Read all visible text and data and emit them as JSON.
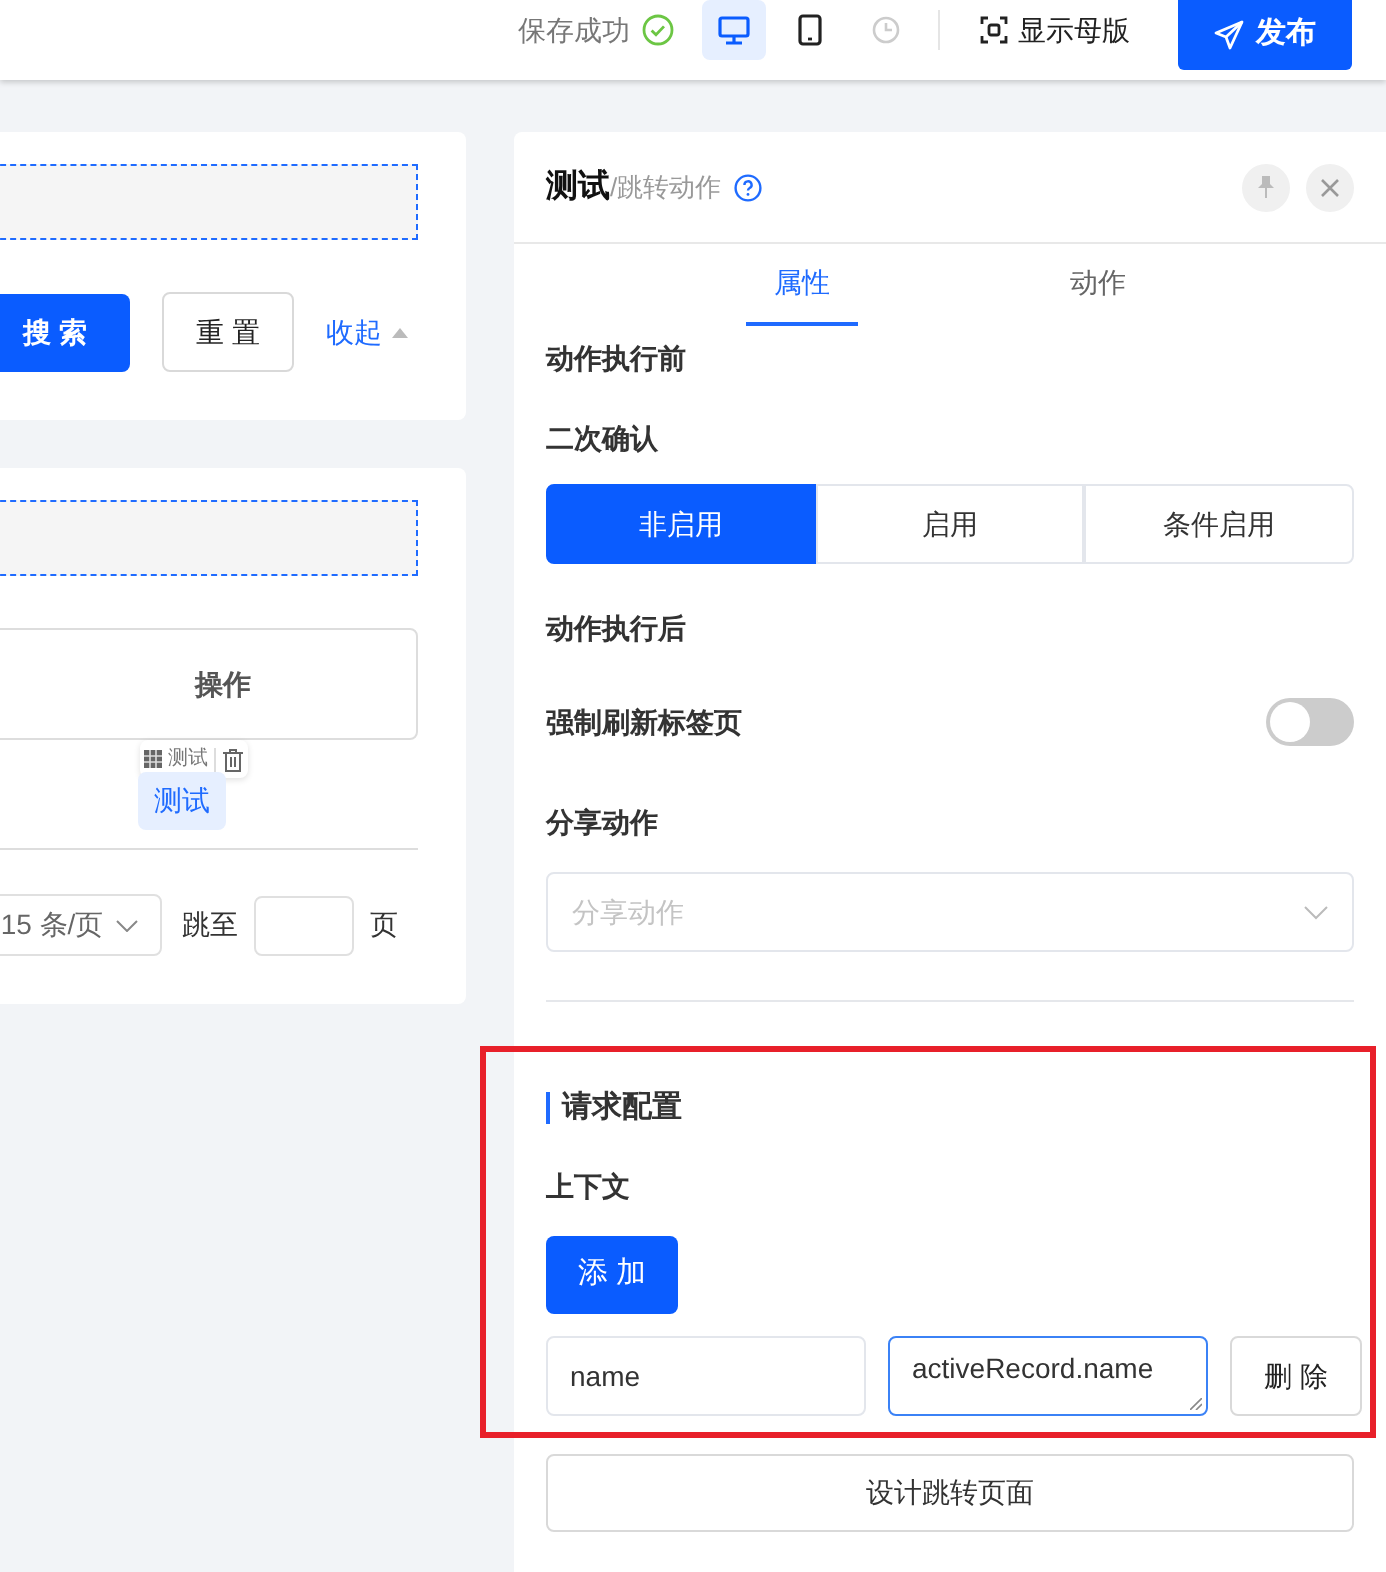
{
  "toolbar": {
    "save_status": "保存成功",
    "devices": [
      {
        "kind": "desktop",
        "selected": true
      },
      {
        "kind": "mobile",
        "selected": false
      }
    ],
    "history_disabled": true,
    "show_master": "显示母版",
    "publish": "发布"
  },
  "search_card": {
    "search_button": "搜 索",
    "reset_button": "重 置",
    "collapse_link": "收起"
  },
  "table_card": {
    "column_header": "操作",
    "component_tooltip": "测试",
    "action_tag": "测试",
    "page_size": "15 条/页",
    "jump_label": "跳至",
    "page_unit": "页"
  },
  "panel": {
    "title": "测试",
    "subtitle": "/跳转动作",
    "tabs": [
      {
        "label": "属性",
        "selected": true
      },
      {
        "label": "动作",
        "selected": false
      }
    ],
    "before_heading": "动作执行前",
    "confirm_label": "二次确认",
    "confirm_options": [
      {
        "label": "非启用",
        "selected": true
      },
      {
        "label": "启用",
        "selected": false
      },
      {
        "label": "条件启用",
        "selected": false
      }
    ],
    "after_heading": "动作执行后",
    "refresh_label": "强制刷新标签页",
    "refresh_on": false,
    "share_label": "分享动作",
    "share_placeholder": "分享动作",
    "request_heading": "请求配置",
    "context_label": "上下文",
    "add_button": "添 加",
    "context_rows": [
      {
        "key": "name",
        "value": "activeRecord.name",
        "delete": "删 除"
      }
    ],
    "design_button": "设计跳转页面"
  }
}
